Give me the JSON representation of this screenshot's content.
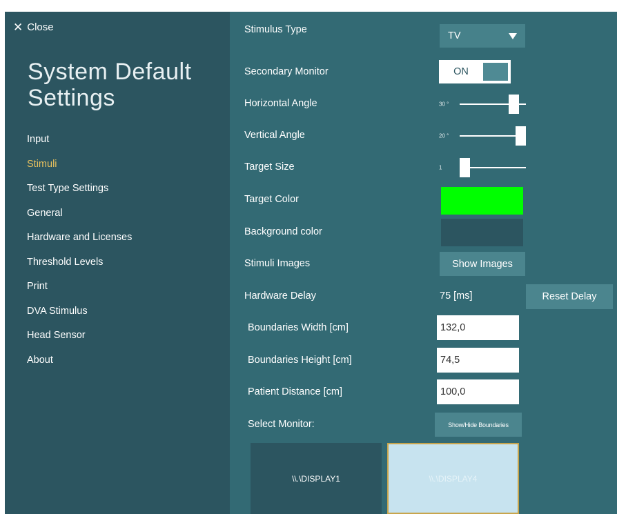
{
  "sidebar": {
    "close_label": "Close",
    "title_line1": "System Default",
    "title_line2": "Settings",
    "items": [
      {
        "label": "Input",
        "active": false
      },
      {
        "label": "Stimuli",
        "active": true
      },
      {
        "label": "Test Type Settings",
        "active": false
      },
      {
        "label": "General",
        "active": false
      },
      {
        "label": "Hardware and Licenses",
        "active": false
      },
      {
        "label": "Threshold Levels",
        "active": false
      },
      {
        "label": "Print",
        "active": false
      },
      {
        "label": "DVA Stimulus",
        "active": false
      },
      {
        "label": "Head Sensor",
        "active": false
      },
      {
        "label": "About",
        "active": false
      }
    ]
  },
  "settings": {
    "stimulus_type": {
      "label": "Stimulus Type",
      "value": "TV"
    },
    "secondary_monitor": {
      "label": "Secondary Monitor",
      "value": "ON"
    },
    "horizontal_angle": {
      "label": "Horizontal Angle",
      "value_text": "30 °",
      "level": 0.88
    },
    "vertical_angle": {
      "label": "Vertical Angle",
      "value_text": "20 °",
      "level": 1.0
    },
    "target_size": {
      "label": "Target Size",
      "value_text": "1",
      "level": 0.0
    },
    "target_color": {
      "label": "Target Color",
      "color": "#00ff00"
    },
    "background_color": {
      "label": "Background color",
      "color": "#2c5560"
    },
    "stimuli_images": {
      "label": "Stimuli Images",
      "button_label": "Show Images"
    },
    "hardware_delay": {
      "label": "Hardware Delay",
      "value": "75 [ms]",
      "button_label": "Reset Delay"
    },
    "boundaries_width": {
      "label": "Boundaries Width  [cm]",
      "value": "132,0"
    },
    "boundaries_height": {
      "label": "Boundaries Height  [cm]",
      "value": "74,5"
    },
    "patient_distance": {
      "label": "Patient Distance  [cm]",
      "value": "100,0"
    },
    "select_monitor": {
      "label": "Select Monitor:",
      "button_label": "Show/Hide Boundaries"
    }
  },
  "monitors": [
    {
      "label": "\\\\.\\DISPLAY1",
      "selected": false
    },
    {
      "label": "\\\\.\\DISPLAY4",
      "selected": true
    }
  ],
  "colors": {
    "sidebar_bg": "#2c5560",
    "main_bg": "#336a74",
    "active_nav": "#e8c15e",
    "button_bg": "#4b858e",
    "selected_monitor_bg": "#c7e3ef",
    "selected_monitor_border": "#c8a54c"
  }
}
